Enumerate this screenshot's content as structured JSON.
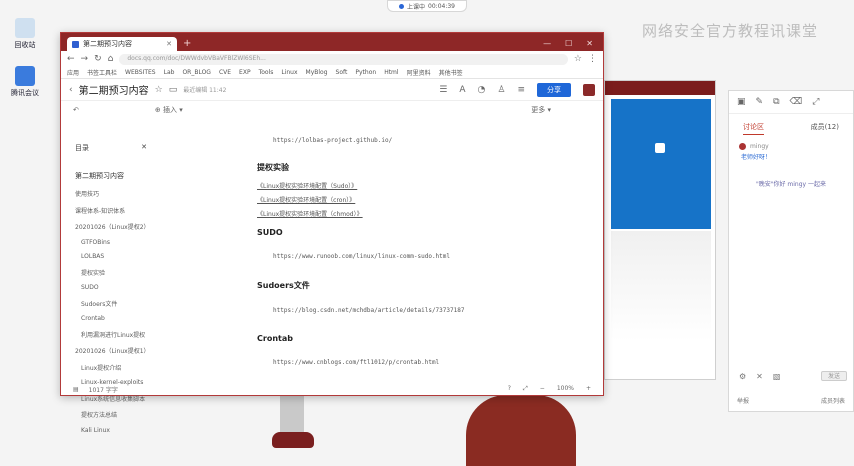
{
  "desktop": {
    "icons": [
      {
        "label": "回收站",
        "icon": "recycle-bin-icon",
        "color": "#cfe0f0"
      },
      {
        "label": "腾讯会议",
        "icon": "meeting-app-icon",
        "color": "#3a7bdd"
      }
    ],
    "meeting_pill": {
      "status": "上课中",
      "time": "00:04:39"
    },
    "watermark": "网络安全官方教程讯课堂"
  },
  "chat_panel": {
    "tabs": [
      "讨论区",
      "成员(12)"
    ],
    "active_tab": "讨论区",
    "message_user": "mingy",
    "message_text": "老师好呀！",
    "notice": "\"晚安\"你好 mingy 一起来",
    "send_label": "发送",
    "footer_left": "举报",
    "footer_right": "成员列表"
  },
  "browser": {
    "tab_title": "第二期预习内容",
    "url": "docs.qq.com/doc/DWWdvbVBaVFBlZWl6SEh...",
    "bookmarks": [
      "应用",
      "书签工具栏",
      "WEBSITES",
      "Lab",
      "OR_BLOG",
      "CVE",
      "EXP",
      "Tools",
      "Linux",
      "MyBlog",
      "Soft",
      "Python",
      "Html",
      "阿里资料",
      "其他书签"
    ],
    "doc_title": "第二期预习内容",
    "doc_meta": "最近编辑 11:42",
    "share_label": "分享",
    "subhead_left": "插入",
    "subhead_more": "更多",
    "status_left": "1017 字字",
    "zoom": "100%"
  },
  "sidebar": {
    "title": "目录",
    "items": [
      {
        "label": "第二期预习内容",
        "level": 0
      },
      {
        "label": "使用技巧",
        "level": 1
      },
      {
        "label": "课程体系-知识体系",
        "level": 1
      },
      {
        "label": "20201026（Linux提权2）",
        "level": 1
      },
      {
        "label": "GTFOBins",
        "level": 2
      },
      {
        "label": "LOLBAS",
        "level": 2
      },
      {
        "label": "提权实验",
        "level": 2
      },
      {
        "label": "SUDO",
        "level": 2
      },
      {
        "label": "Sudoers文件",
        "level": 2
      },
      {
        "label": "Crontab",
        "level": 2
      },
      {
        "label": "利用漏洞进行Linux提权",
        "level": 2
      },
      {
        "label": "20201026（Linux提权1）",
        "level": 1
      },
      {
        "label": "Linux提权介绍",
        "level": 2
      },
      {
        "label": "Linux-kernel-exploits",
        "level": 2
      },
      {
        "label": "Linux系统信息收集脚本",
        "level": 2
      },
      {
        "label": "提权方法总结",
        "level": 2
      },
      {
        "label": "Kali Linux",
        "level": 2
      }
    ]
  },
  "content": {
    "top_link": "https://lolbas-project.github.io/",
    "section1_title": "提权实验",
    "section1_links": [
      "《Linux提权实验环境配置（Sudo）》",
      "《Linux提权实验环境配置（cron）》",
      "《Linux提权实验环境配置（chmod）》"
    ],
    "section2_title": "SUDO",
    "section2_link": "https://www.runoob.com/linux/linux-comm-sudo.html",
    "section3_title": "Sudoers文件",
    "section3_link": "https://blog.csdn.net/mchdba/article/details/73737187",
    "section4_title": "Crontab",
    "section4_link": "https://www.cnblogs.com/ftl1012/p/crontab.html"
  },
  "colors": {
    "titlebar": "#8e2727",
    "accent_blue": "#1f67d8",
    "bg_window_blue": "#1673c8"
  }
}
